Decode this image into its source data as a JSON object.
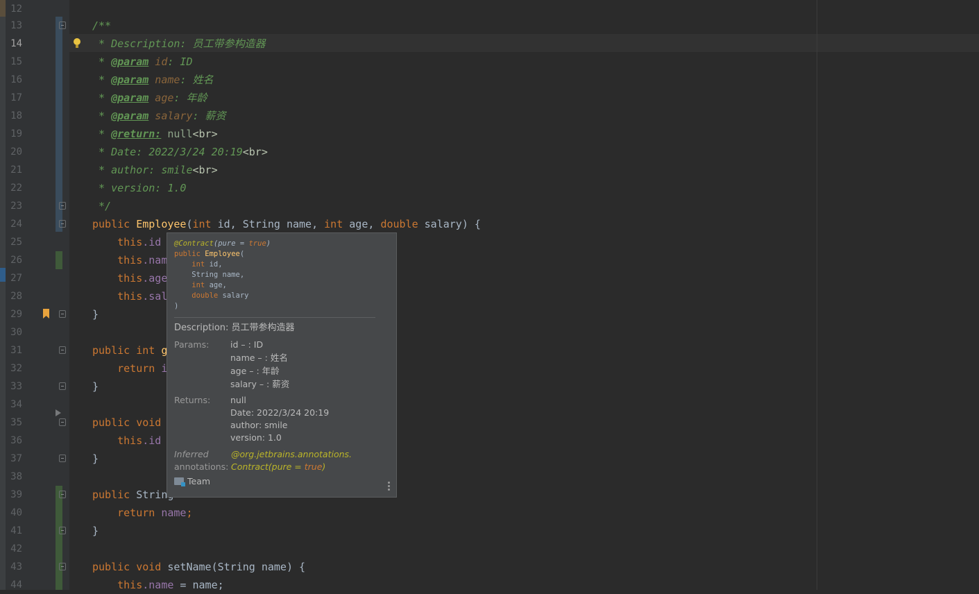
{
  "gutter": {
    "line_numbers": [
      "12",
      "13",
      "14",
      "15",
      "16",
      "17",
      "18",
      "19",
      "20",
      "21",
      "22",
      "23",
      "24",
      "25",
      "26",
      "27",
      "28",
      "29",
      "30",
      "31",
      "32",
      "33",
      "34",
      "35",
      "36",
      "37",
      "38",
      "39",
      "40",
      "41",
      "42",
      "43",
      "44"
    ]
  },
  "code": {
    "l13": "/**",
    "l14_a": " * Description: ",
    "l14_b": "员工带参构造器",
    "l15_a": " * ",
    "l15_tag": "@param",
    "l15_p": " id",
    "l15_b": ": ID",
    "l16_a": " * ",
    "l16_tag": "@param",
    "l16_p": " name",
    "l16_b": ": 姓名",
    "l17_a": " * ",
    "l17_tag": "@param",
    "l17_p": " age",
    "l17_b": ": 年龄",
    "l18_a": " * ",
    "l18_tag": "@param",
    "l18_p": " salary",
    "l18_b": ": 薪资",
    "l19_a": " * ",
    "l19_tag": "@return:",
    "l19_b": " null",
    "l19_c": "<br>",
    "l20_a": " * Date: 2022/3/24 20:19",
    "l20_c": "<br>",
    "l21_a": " * author: smile",
    "l21_c": "<br>",
    "l22": " * version: 1.0",
    "l23": " */",
    "l24_kw1": "public ",
    "l24_fn": "Employee",
    "l24_p1": "(",
    "l24_kw2": "int",
    "l24_p2": " id, ",
    "l24_t1": "String",
    "l24_p3": " name, ",
    "l24_kw3": "int",
    "l24_p4": " age, ",
    "l24_kw4": "double",
    "l24_p5": " salary) {",
    "l25_kw": "    this",
    "l25_f": ".id",
    "l26_kw": "    this",
    "l26_f": ".nam",
    "l27_kw": "    this",
    "l27_f": ".age",
    "l28_kw": "    this",
    "l28_f": ".sal",
    "l29": "}",
    "l31_kw": "public int ",
    "l31_b": "g",
    "l32_kw": "    return ",
    "l32_b": "i",
    "l33": "}",
    "l35_kw": "public void ",
    "l36_kw": "    this",
    "l36_f": ".id",
    "l37": "}",
    "l39_kw": "public ",
    "l39_b": "String",
    "l40_kw": "    return ",
    "l40_f": "name",
    "l40_b": ";",
    "l41": "}",
    "l43_kw": "public void ",
    "l43_m": "setName",
    "l43_b": "(String name) {",
    "l44_kw": "    this",
    "l44_f": ".name",
    "l44_b": " = name;"
  },
  "popup": {
    "sig_ann": "@Contract",
    "sig_ann_args_a": "(pure = ",
    "sig_ann_lit": "true",
    "sig_ann_args_b": ")",
    "sig_kw": "public ",
    "sig_fn": "Employee",
    "sig_open": "(",
    "sig_p1_type": "    int",
    "sig_p1_name": " id,",
    "sig_p2_type": "    String",
    "sig_p2_name": " name,",
    "sig_p3_type": "    int",
    "sig_p3_name": " age,",
    "sig_p4_type": "    double",
    "sig_p4_name": " salary",
    "sig_close": ")",
    "description": "Description: 员工带参构造器",
    "params_label": "Params:",
    "params": [
      "id – : ID",
      "name – : 姓名",
      "age – : 年龄",
      "salary – : 薪资"
    ],
    "returns_label": "Returns:",
    "returns": [
      "null",
      "Date: 2022/3/24 20:19",
      "author: smile",
      "version: 1.0"
    ],
    "inferred_label_1": "Inferred",
    "inferred_label_2": "annotations:",
    "inferred_val_1": "@org.jetbrains.annotations.",
    "inferred_val_2a": "Contract(pure = ",
    "inferred_val_2lit": "true",
    "inferred_val_2b": ")",
    "team": "Team"
  },
  "colors": {
    "background": "#2b2b2b",
    "gutter": "#313335",
    "comment": "#629755",
    "keyword": "#cc7832",
    "method": "#ffc66d",
    "field": "#9876aa",
    "popup_bg": "#46484a",
    "annotation": "#bbb529"
  }
}
